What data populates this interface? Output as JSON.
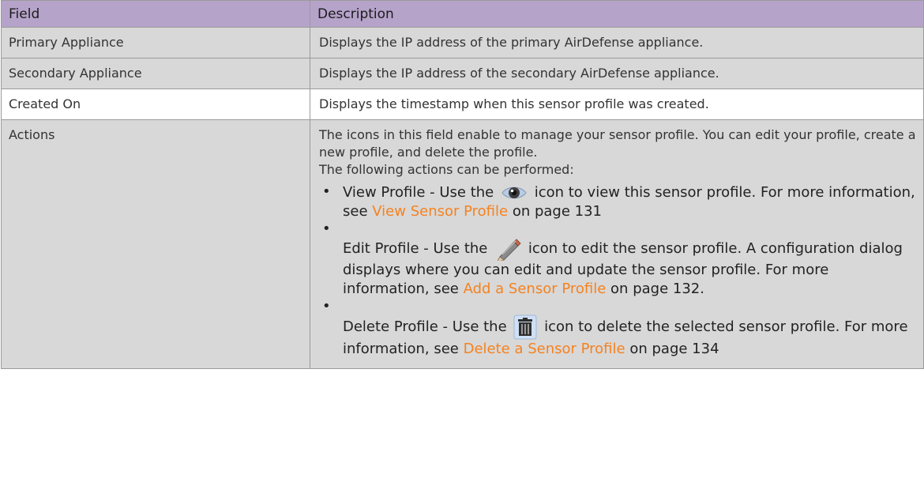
{
  "header": {
    "field": "Field",
    "description": "Description"
  },
  "rows": [
    {
      "field": "Primary Appliance",
      "description": "Displays the IP address of the primary AirDefense appliance."
    },
    {
      "field": "Secondary Appliance",
      "description": "Displays the IP address of the secondary AirDefense appliance."
    },
    {
      "field": "Created On",
      "description": "Displays the timestamp when this sensor profile was created."
    }
  ],
  "actions": {
    "field": "Actions",
    "intro": "The icons in this field enable to manage your sensor profile. You can edit your profile, create a new profile, and delete the profile.",
    "intro2": "The following actions can be performed:",
    "items": [
      {
        "pre": "View Profile - Use the",
        "icon": "eye-icon",
        "post": "icon to view this sensor profile. For more information, see",
        "link": "View Sensor Profile",
        "tail": "on page 131"
      },
      {
        "pre": "Edit Profile - Use the",
        "icon": "pencil-icon",
        "post": "icon to edit the sensor profile. A configuration dialog displays where you can edit and update the sensor profile. For more information, see",
        "link": "Add a Sensor Profile",
        "tail": "on page 132."
      },
      {
        "pre": "Delete Profile - Use the",
        "icon": "trash-icon",
        "post": "icon to delete the selected sensor profile. For more information, see",
        "link": "Delete a Sensor Profile",
        "tail": "on page 134"
      }
    ]
  },
  "colors": {
    "header_bg": "#b6a3ca",
    "alt_row": "#d8d8d8",
    "link": "#f58220"
  }
}
